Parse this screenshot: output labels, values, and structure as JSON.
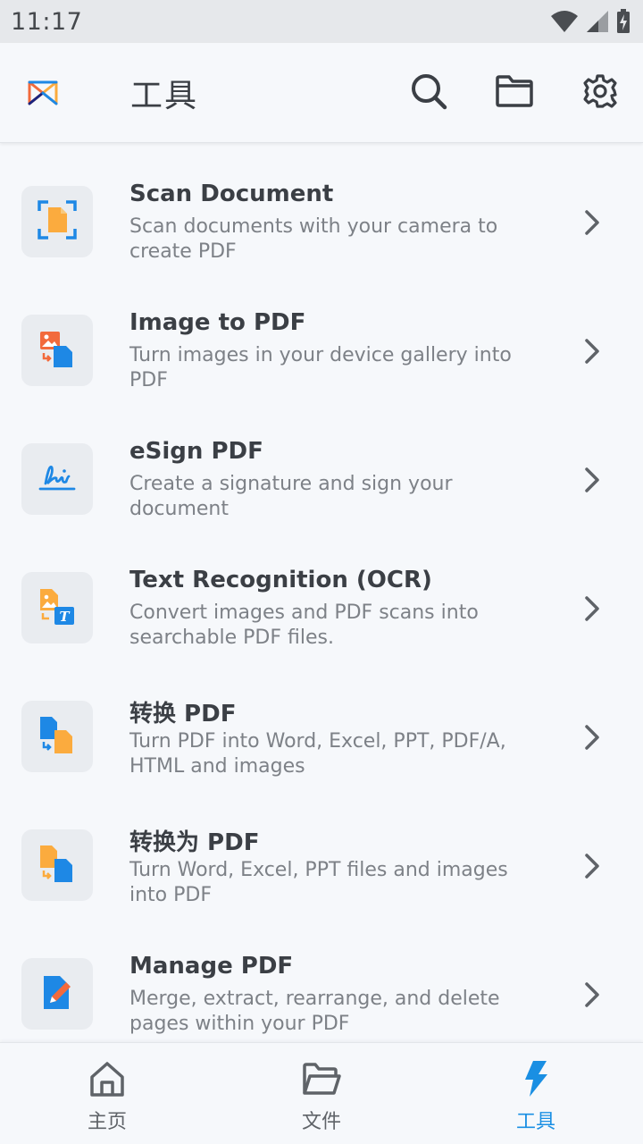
{
  "status_bar": {
    "time": "11:17"
  },
  "app_bar": {
    "title": "工具"
  },
  "tools": [
    {
      "title": "Scan Document",
      "description": "Scan documents with your camera to create PDF",
      "icon": "scan-document-icon"
    },
    {
      "title": "Image to PDF",
      "description": "Turn images in your device gallery into PDF",
      "icon": "image-to-pdf-icon"
    },
    {
      "title": "eSign PDF",
      "description": "Create a signature and sign your document",
      "icon": "esign-icon"
    },
    {
      "title": "Text Recognition (OCR)",
      "description": "Convert images and PDF scans into searchable PDF files.",
      "icon": "ocr-icon"
    },
    {
      "title": "转换 PDF",
      "description": "Turn PDF into Word, Excel, PPT, PDF/A, HTML and images",
      "icon": "convert-pdf-icon"
    },
    {
      "title": "转换为 PDF",
      "description": "Turn Word, Excel, PPT files and images into PDF",
      "icon": "convert-to-pdf-icon"
    },
    {
      "title": "Manage PDF",
      "description": "Merge, extract, rearrange, and delete pages within your PDF",
      "icon": "manage-pdf-icon"
    }
  ],
  "bottom_nav": [
    {
      "label": "主页",
      "icon": "home-icon",
      "active": false
    },
    {
      "label": "文件",
      "icon": "folder-open-icon",
      "active": false
    },
    {
      "label": "工具",
      "icon": "lightning-icon",
      "active": true
    }
  ],
  "colors": {
    "accent": "#1a8fe3",
    "orange": "#fbab3e",
    "red_orange": "#f26a3c",
    "blue": "#1e88e5",
    "background": "#f6f8fb"
  }
}
